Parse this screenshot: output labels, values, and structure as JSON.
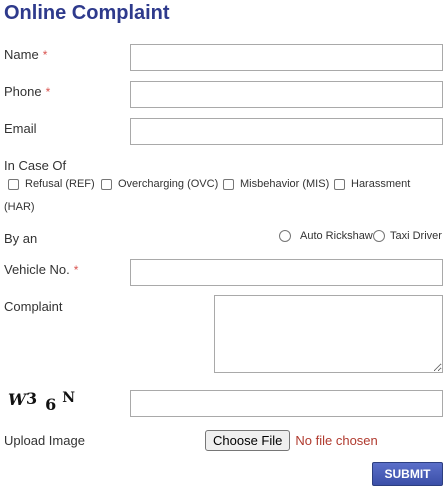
{
  "form": {
    "title": "Online Complaint",
    "required_marker": "*",
    "name": {
      "label": "Name",
      "value": ""
    },
    "phone": {
      "label": "Phone",
      "value": ""
    },
    "email": {
      "label": "Email",
      "value": ""
    },
    "in_case_of": {
      "label": "In Case Of",
      "options": [
        {
          "label": "Refusal (REF)",
          "checked": false
        },
        {
          "label": "Overcharging (OVC)",
          "checked": false
        },
        {
          "label": "Misbehavior (MIS)",
          "checked": false
        },
        {
          "label": "Harassment",
          "checked": false
        }
      ],
      "wrap_text": "(HAR)"
    },
    "by_an": {
      "label": "By an",
      "options": [
        {
          "label": "Auto Rickshaw",
          "selected": false
        },
        {
          "label": "Taxi Driver",
          "selected": false
        }
      ]
    },
    "vehicle_no": {
      "label": "Vehicle No.",
      "value": ""
    },
    "complaint": {
      "label": "Complaint",
      "value": ""
    },
    "captcha": {
      "chars": [
        "W",
        "3",
        "6",
        "N"
      ],
      "value": ""
    },
    "upload_image": {
      "label": "Upload Image",
      "button_label": "Choose File",
      "status": "No file chosen"
    },
    "submit_label": "SUBMIT"
  },
  "colors": {
    "title": "#2e3a8c",
    "required": "#d9534f",
    "no_file": "#b03a2e",
    "submit_bg": "#3b4fa8"
  }
}
